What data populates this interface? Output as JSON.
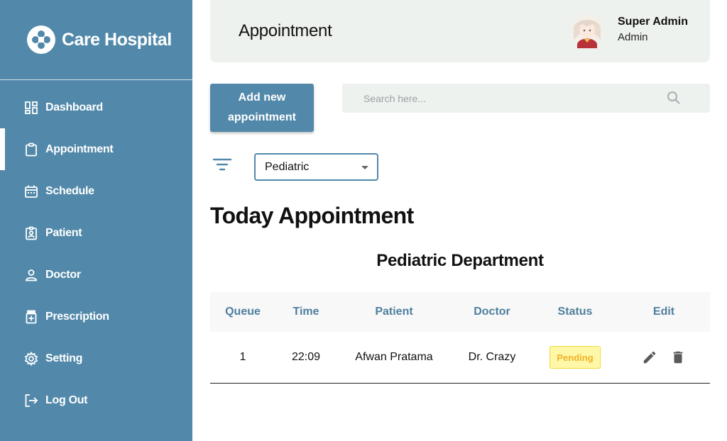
{
  "brand": {
    "name": "Care Hospital"
  },
  "sidebar": {
    "items": [
      {
        "label": "Dashboard",
        "icon": "dashboard-icon",
        "active": false
      },
      {
        "label": "Appointment",
        "icon": "clipboard-icon",
        "active": true
      },
      {
        "label": "Schedule",
        "icon": "calendar-icon",
        "active": false
      },
      {
        "label": "Patient",
        "icon": "patient-badge-icon",
        "active": false
      },
      {
        "label": "Doctor",
        "icon": "person-icon",
        "active": false
      },
      {
        "label": "Prescription",
        "icon": "medicine-icon",
        "active": false
      },
      {
        "label": "Setting",
        "icon": "gear-icon",
        "active": false
      },
      {
        "label": "Log Out",
        "icon": "logout-icon",
        "active": false
      }
    ]
  },
  "header": {
    "title": "Appointment",
    "user": {
      "name": "Super Admin",
      "role": "Admin"
    }
  },
  "toolbar": {
    "add_label": "Add new appointment",
    "search_placeholder": "Search here...",
    "filter_value": "Pediatric"
  },
  "main": {
    "section_title": "Today Appointment",
    "department_title": "Pediatric Department"
  },
  "table": {
    "columns": [
      "Queue",
      "Time",
      "Patient",
      "Doctor",
      "Status",
      "Edit"
    ],
    "rows": [
      {
        "queue": "1",
        "time": "22:09",
        "patient": "Afwan Pratama",
        "doctor": "Dr. Crazy",
        "status": "Pending"
      }
    ]
  },
  "colors": {
    "primary": "#5289aa",
    "header_bg": "#eef2ee",
    "pending_bg": "#fff7a8",
    "pending_text": "#f0b228"
  }
}
